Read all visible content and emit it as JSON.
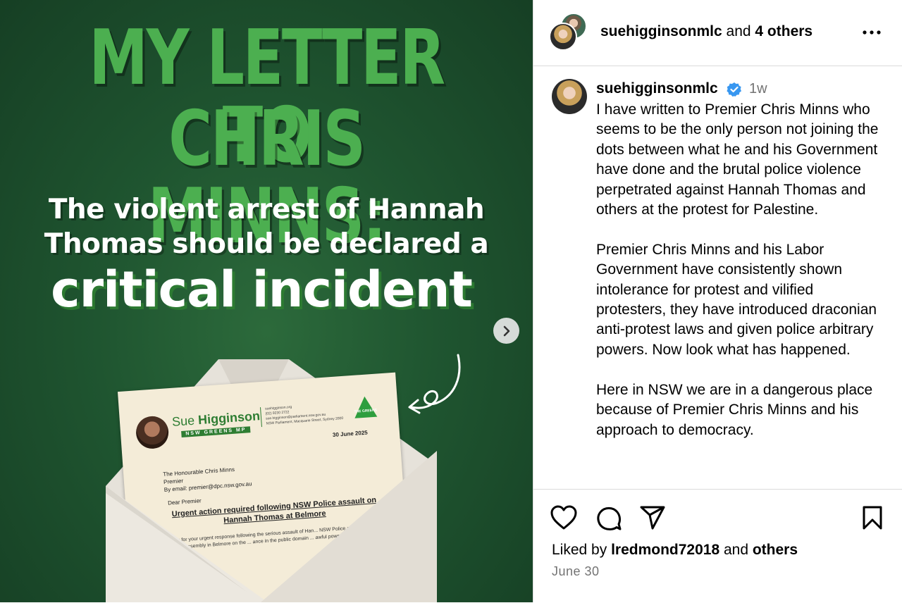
{
  "colors": {
    "headline_green": "#4caf50",
    "panel_bg": "#ffffff",
    "verified_blue": "#3897f0",
    "muted_text": "#737373"
  },
  "media": {
    "headline_line1": "MY LETTER TO",
    "headline_line2": "CHRIS MINNS:",
    "subtitle_line1": "The violent arrest of Hannah",
    "subtitle_line2": "Thomas should be declared a",
    "emphasis": "critical incident",
    "next_icon": "chevron-right-icon",
    "letter": {
      "sender_first": "Sue",
      "sender_last": "Higginson",
      "sender_tag": "NSW GREENS MP",
      "logo_text": "THE GREENS",
      "contact_lines": [
        "suehigginson.org",
        "(02) 9230 2722",
        "sue.higginson@parliament.nsw.gov.au",
        "NSW Parliament, Macquarie Street, Sydney 2000"
      ],
      "date": "30 June 2025",
      "address_lines": [
        "The Honourable Chris Minns",
        "Premier",
        "By email: premier@dpc.nsw.gov.au"
      ],
      "salutation": "Dear Premier",
      "subject": "Urgent action required following NSW Police assault on Hannah Thomas at Belmore",
      "body": "...ng for your urgent response following the serious assault of Han... NSW Police at a public assembly in Belmore on the ... ance in the public domain ... awful powers. ..."
    }
  },
  "header": {
    "username": "suehigginsonmlc",
    "joiner": " and ",
    "others": "4 others",
    "more_icon": "more-horizontal-icon"
  },
  "caption": {
    "username": "suehigginsonmlc",
    "time": "1w",
    "text": "I have written to Premier Chris Minns who seems to be the only person not joining the dots between what he and his Government have done and the brutal police violence perpetrated against Hannah Thomas and others at the protest for Palestine.\n\nPremier Chris Minns and his Labor Government have consistently shown intolerance for protest and vilified protesters, they have introduced draconian anti-protest laws and given police arbitrary powers. Now look what has happened.\n\nHere in NSW we are in a dangerous place because of Premier Chris Minns and his approach to democracy."
  },
  "actions": {
    "icons": [
      "heart-icon",
      "comment-icon",
      "share-icon",
      "bookmark-icon"
    ],
    "liked_prefix": "Liked by ",
    "liked_user": "lredmond72018",
    "liked_joiner": " and ",
    "liked_others": "others",
    "date": "June 30"
  }
}
